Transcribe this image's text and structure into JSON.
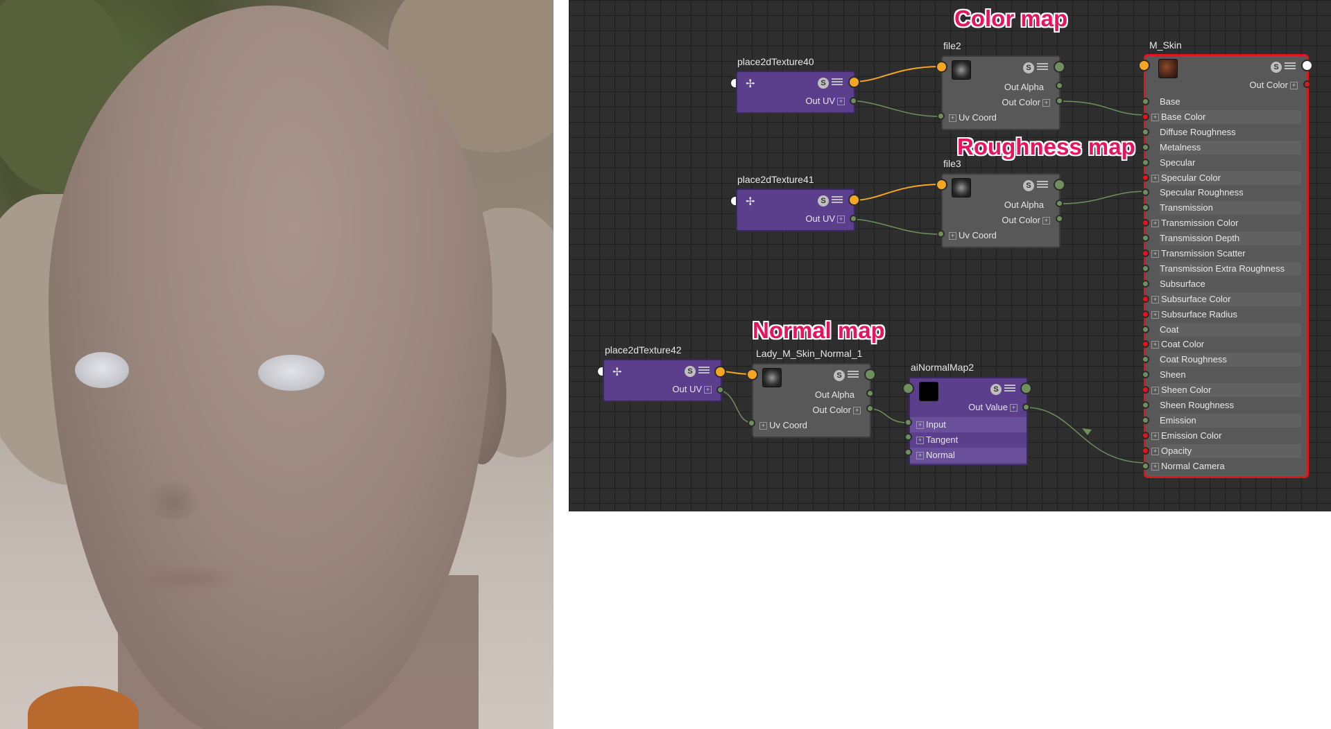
{
  "annotations": {
    "color_map": "Color map",
    "roughness_map": "Roughness map",
    "normal_map": "Normal map"
  },
  "nodes": {
    "place2d40": {
      "title": "place2dTexture40",
      "out_uv": "Out UV"
    },
    "place2d41": {
      "title": "place2dTexture41",
      "out_uv": "Out UV"
    },
    "place2d42": {
      "title": "place2dTexture42",
      "out_uv": "Out UV"
    },
    "file2": {
      "title": "file2",
      "out_alpha": "Out Alpha",
      "out_color": "Out Color",
      "uv_coord": "Uv Coord"
    },
    "file3": {
      "title": "file3",
      "out_alpha": "Out Alpha",
      "out_color": "Out Color",
      "uv_coord": "Uv Coord"
    },
    "normal_file": {
      "title": "Lady_M_Skin_Normal_1",
      "out_alpha": "Out Alpha",
      "out_color": "Out Color",
      "uv_coord": "Uv Coord"
    },
    "normal_map": {
      "title": "aiNormalMap2",
      "out_value": "Out Value",
      "input": "Input",
      "tangent": "Tangent",
      "normal": "Normal"
    },
    "material": {
      "title": "M_Skin",
      "out_color": "Out Color",
      "attributes": [
        "Base",
        "Base Color",
        "Diffuse Roughness",
        "Metalness",
        "Specular",
        "Specular Color",
        "Specular Roughness",
        "Transmission",
        "Transmission Color",
        "Transmission Depth",
        "Transmission Scatter",
        "Transmission Extra Roughness",
        "Subsurface",
        "Subsurface Color",
        "Subsurface Radius",
        "Coat",
        "Coat Color",
        "Coat Roughness",
        "Sheen",
        "Sheen Color",
        "Sheen Roughness",
        "Emission",
        "Emission Color",
        "Opacity",
        "Normal Camera"
      ]
    }
  },
  "icons": {
    "shader_swatch": "S",
    "attribute_list": "list-icon",
    "place2d": "place2d-icon",
    "file_thumb": "texture-thumb"
  },
  "colors": {
    "editor_bg": "#2e2e2e",
    "purple_node": "#5b3f8c",
    "gray_node": "#585858",
    "port_orange": "#f5a623",
    "port_green": "#6f8f5c",
    "port_red": "#e0161c",
    "selected_outline": "#e0161c",
    "annotation": "#e8135e"
  }
}
